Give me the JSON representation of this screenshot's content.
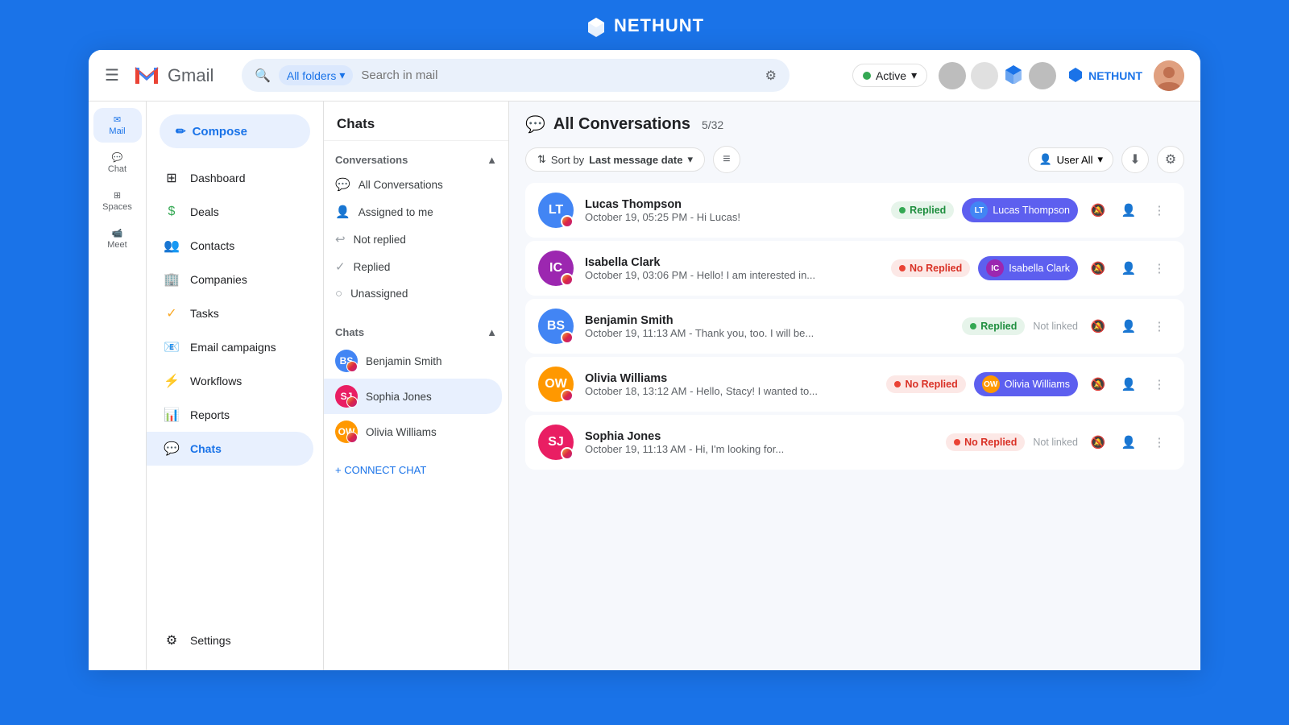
{
  "topbar": {
    "logo_text": "NETHUNT"
  },
  "header": {
    "hamburger_label": "☰",
    "gmail_label": "Gmail",
    "folder_label": "All folders",
    "search_placeholder": "Search in mail",
    "active_label": "Active",
    "nethunt_label": "NETHUNT"
  },
  "icon_sidebar": {
    "items": [
      {
        "id": "mail",
        "label": "Mail",
        "active": true
      },
      {
        "id": "chat",
        "label": "Chat",
        "active": false
      },
      {
        "id": "spaces",
        "label": "Spaces",
        "active": false
      },
      {
        "id": "meet",
        "label": "Meet",
        "active": false
      }
    ]
  },
  "left_nav": {
    "compose_label": "Compose",
    "items": [
      {
        "id": "dashboard",
        "label": "Dashboard",
        "icon": "⊞"
      },
      {
        "id": "deals",
        "label": "Deals",
        "icon": "💲"
      },
      {
        "id": "contacts",
        "label": "Contacts",
        "icon": "👥"
      },
      {
        "id": "companies",
        "label": "Companies",
        "icon": "🏢"
      },
      {
        "id": "tasks",
        "label": "Tasks",
        "icon": "✓"
      },
      {
        "id": "email-campaigns",
        "label": "Email campaigns",
        "icon": "📧"
      },
      {
        "id": "workflows",
        "label": "Workflows",
        "icon": "⚡"
      },
      {
        "id": "reports",
        "label": "Reports",
        "icon": "📊"
      },
      {
        "id": "chats",
        "label": "Chats",
        "icon": "💬",
        "active": true
      },
      {
        "id": "settings",
        "label": "Settings",
        "icon": "⚙"
      }
    ]
  },
  "chat_panel": {
    "title": "Chats",
    "conversations_label": "Conversations",
    "conversations_items": [
      {
        "id": "all",
        "label": "All Conversations",
        "icon": "💬"
      },
      {
        "id": "assigned",
        "label": "Assigned to me",
        "icon": "👤"
      },
      {
        "id": "not-replied",
        "label": "Not replied",
        "icon": "↩"
      },
      {
        "id": "replied",
        "label": "Replied",
        "icon": "✓"
      },
      {
        "id": "unassigned",
        "label": "Unassigned",
        "icon": "○"
      }
    ],
    "chats_label": "Chats",
    "chat_contacts": [
      {
        "id": "benjamin",
        "name": "Benjamin Smith",
        "color": "#4285f4"
      },
      {
        "id": "sophia",
        "name": "Sophia Jones",
        "color": "#e91e63",
        "active": true
      },
      {
        "id": "olivia",
        "name": "Olivia Williams",
        "color": "#ff9800"
      }
    ],
    "connect_chat_label": "+ CONNECT CHAT"
  },
  "main": {
    "title": "All Conversations",
    "count": "5/32",
    "sort_label": "Sort by",
    "sort_value": "Last message date",
    "user_filter_label": "User All",
    "conversations": [
      {
        "id": 1,
        "name": "Lucas Thompson",
        "date": "October 19, 05:25 PM",
        "preview": "Hi Lucas!",
        "status": "Replied",
        "status_type": "replied",
        "linked_name": "Lucas Thompson",
        "linked_color": "#5d5fef",
        "avatar_color": "#4285f4",
        "avatar_initials": "LT"
      },
      {
        "id": 2,
        "name": "Isabella Clark",
        "date": "October 19, 03:06 PM",
        "preview": "Hello! I am interested in...",
        "status": "No Replied",
        "status_type": "no-replied",
        "linked_name": "Isabella Clark",
        "linked_color": "#5d5fef",
        "avatar_color": "#9c27b0",
        "avatar_initials": "IC"
      },
      {
        "id": 3,
        "name": "Benjamin Smith",
        "date": "October 19, 11:13 AM",
        "preview": "Thank you, too. I will be...",
        "status": "Replied",
        "status_type": "replied",
        "linked_name": null,
        "not_linked_label": "Not linked",
        "avatar_color": "#4285f4",
        "avatar_initials": "BS"
      },
      {
        "id": 4,
        "name": "Olivia Williams",
        "date": "October 18, 13:12 AM",
        "preview": "Hello, Stacy! I wanted to...",
        "status": "No Replied",
        "status_type": "no-replied",
        "linked_name": "Olivia Williams",
        "linked_color": "#5d5fef",
        "avatar_color": "#ff9800",
        "avatar_initials": "OW"
      },
      {
        "id": 5,
        "name": "Sophia Jones",
        "date": "October 19, 11:13 AM",
        "preview": "Hi, I'm looking for...",
        "status": "No Replied",
        "status_type": "no-replied",
        "linked_name": null,
        "not_linked_label": "Not linked",
        "avatar_color": "#e91e63",
        "avatar_initials": "SJ"
      }
    ]
  }
}
